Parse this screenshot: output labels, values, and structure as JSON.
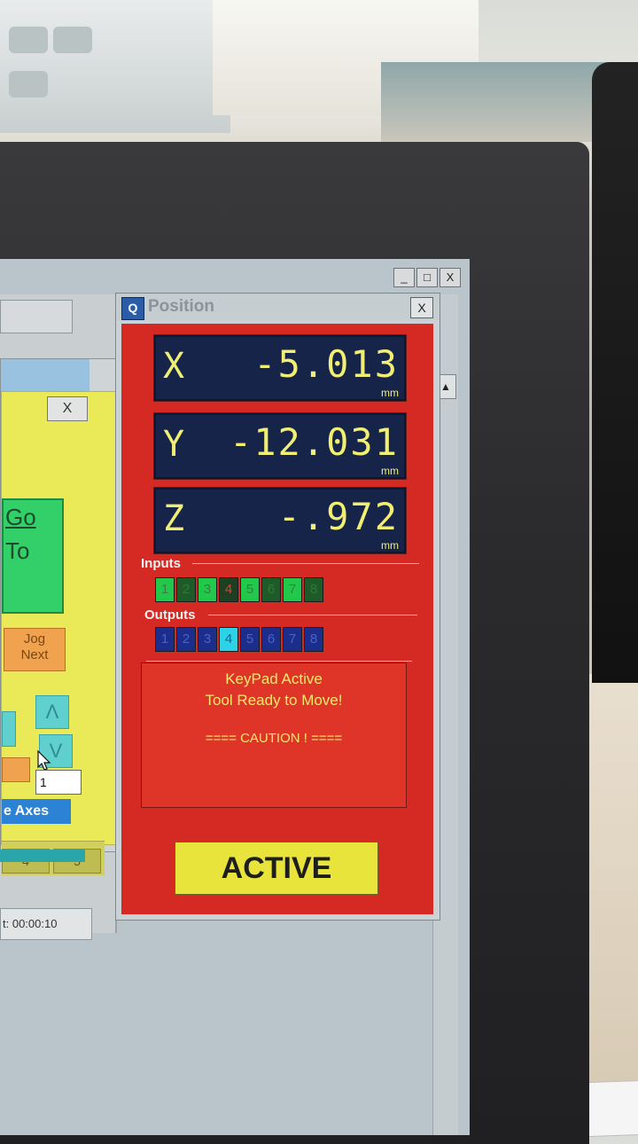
{
  "main_window": {
    "min_label": "_",
    "max_label": "□",
    "close_label": "X",
    "timer_text": "t: 00:00:10",
    "scroll_up_label": "▲"
  },
  "jog_panel": {
    "close_label": "X",
    "goto_line1": "Go",
    "goto_line2": "To",
    "jog_next_line1": "Jog",
    "jog_next_line2": "Next",
    "up_arrow": "Λ",
    "down_arrow": "V",
    "step_value": "1",
    "axes_label": "e Axes",
    "tab_4": "4",
    "tab_5": "5"
  },
  "position_window": {
    "title": "Position",
    "close_label": "X",
    "logo_text": "Q",
    "axes": [
      {
        "axis": "X",
        "value": "-5.013",
        "unit": "mm"
      },
      {
        "axis": "Y",
        "value": "-12.031",
        "unit": "mm"
      },
      {
        "axis": "Z",
        "value": "-.972",
        "unit": "mm"
      }
    ],
    "inputs_label": "Inputs",
    "outputs_label": "Outputs",
    "inputs": [
      {
        "n": "1",
        "state": "on"
      },
      {
        "n": "2",
        "state": "off"
      },
      {
        "n": "3",
        "state": "on"
      },
      {
        "n": "4",
        "state": "red"
      },
      {
        "n": "5",
        "state": "on"
      },
      {
        "n": "6",
        "state": "off"
      },
      {
        "n": "7",
        "state": "on"
      },
      {
        "n": "8",
        "state": "off"
      }
    ],
    "outputs": [
      {
        "n": "1",
        "state": "off"
      },
      {
        "n": "2",
        "state": "off"
      },
      {
        "n": "3",
        "state": "off"
      },
      {
        "n": "4",
        "state": "on"
      },
      {
        "n": "5",
        "state": "off"
      },
      {
        "n": "6",
        "state": "off"
      },
      {
        "n": "7",
        "state": "off"
      },
      {
        "n": "8",
        "state": "off"
      }
    ],
    "message_line1": "KeyPad Active",
    "message_line2": "Tool Ready to Move!",
    "message_line3": "==== CAUTION ! ====",
    "active_label": "ACTIVE"
  },
  "colors": {
    "panel_red": "#d52a24",
    "dro_background": "#16244a",
    "dro_digits": "#f1ee74",
    "active_yellow": "#e8e43c"
  }
}
